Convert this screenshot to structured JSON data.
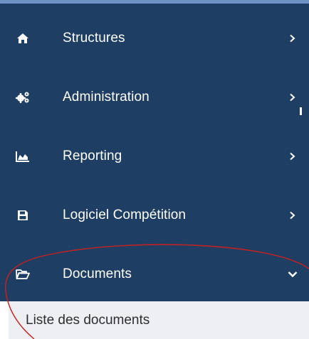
{
  "menu": {
    "items": [
      {
        "label": "Structures",
        "icon": "home-icon",
        "chevron": "right"
      },
      {
        "label": "Administration",
        "icon": "gears-icon",
        "chevron": "right"
      },
      {
        "label": "Reporting",
        "icon": "area-chart-icon",
        "chevron": "right"
      },
      {
        "label": "Logiciel Compétition",
        "icon": "floppy-disk-icon",
        "chevron": "right"
      },
      {
        "label": "Documents",
        "icon": "folder-open-icon",
        "chevron": "down"
      }
    ],
    "submenu": {
      "label": "Liste des documents"
    }
  },
  "colors": {
    "sidebar_bg": "#1e3f63",
    "sidebar_top_border": "#6d93c4",
    "submenu_bg": "#edeff2",
    "annotation": "#cc1f1f"
  }
}
